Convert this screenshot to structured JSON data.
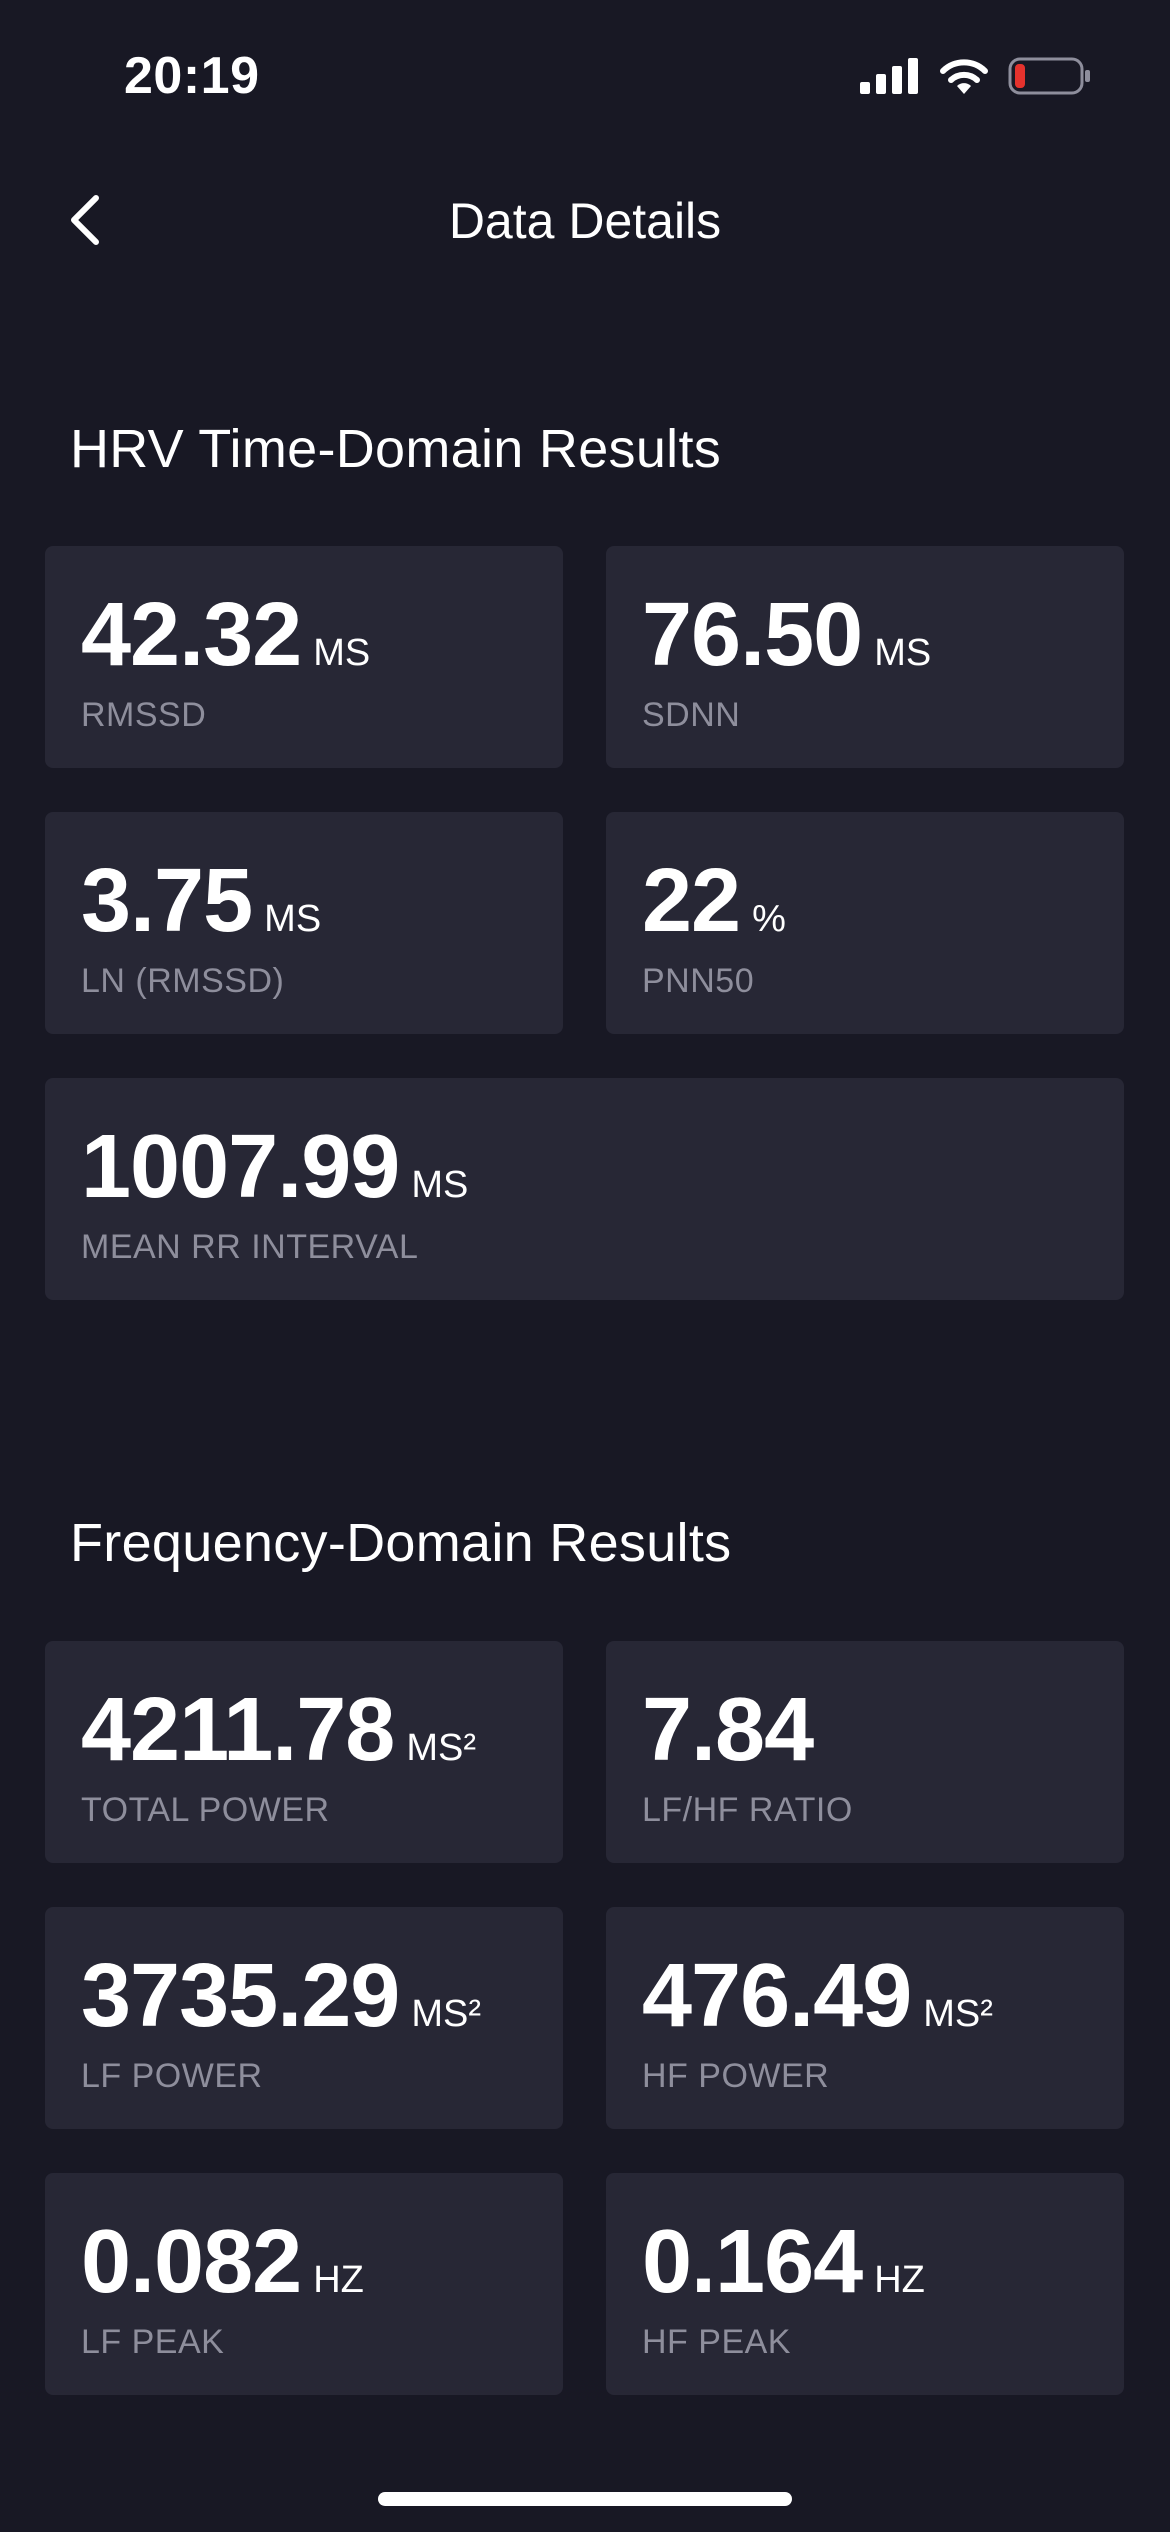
{
  "status_bar": {
    "time": "20:19",
    "icons": [
      "cellular-signal-icon",
      "wifi-icon",
      "battery-low-icon"
    ],
    "battery_color": "#e5322d"
  },
  "header": {
    "back_icon": "chevron-left-icon",
    "title": "Data Details"
  },
  "time_domain": {
    "title": "HRV Time-Domain Results",
    "metrics": [
      {
        "value": "42.32",
        "unit": "MS",
        "label": "RMSSD"
      },
      {
        "value": "76.50",
        "unit": "MS",
        "label": "SDNN"
      },
      {
        "value": "3.75",
        "unit": "MS",
        "label": "LN (RMSSD)"
      },
      {
        "value": "22",
        "unit": "%",
        "label": "PNN50"
      },
      {
        "value": "1007.99",
        "unit": "MS",
        "label": "MEAN RR INTERVAL"
      }
    ]
  },
  "frequency_domain": {
    "title": "Frequency-Domain Results",
    "metrics": [
      {
        "value": "4211.78",
        "unit": "MS²",
        "label": "TOTAL POWER"
      },
      {
        "value": "7.84",
        "unit": "",
        "label": "LF/HF RATIO"
      },
      {
        "value": "3735.29",
        "unit": "MS²",
        "label": "LF POWER"
      },
      {
        "value": "476.49",
        "unit": "MS²",
        "label": "HF POWER"
      },
      {
        "value": "0.082",
        "unit": "HZ",
        "label": "LF PEAK"
      },
      {
        "value": "0.164",
        "unit": "HZ",
        "label": "HF PEAK"
      }
    ]
  },
  "colors": {
    "background": "#181824",
    "card": "#272735",
    "label": "#8e8e9c",
    "text": "#ffffff"
  }
}
